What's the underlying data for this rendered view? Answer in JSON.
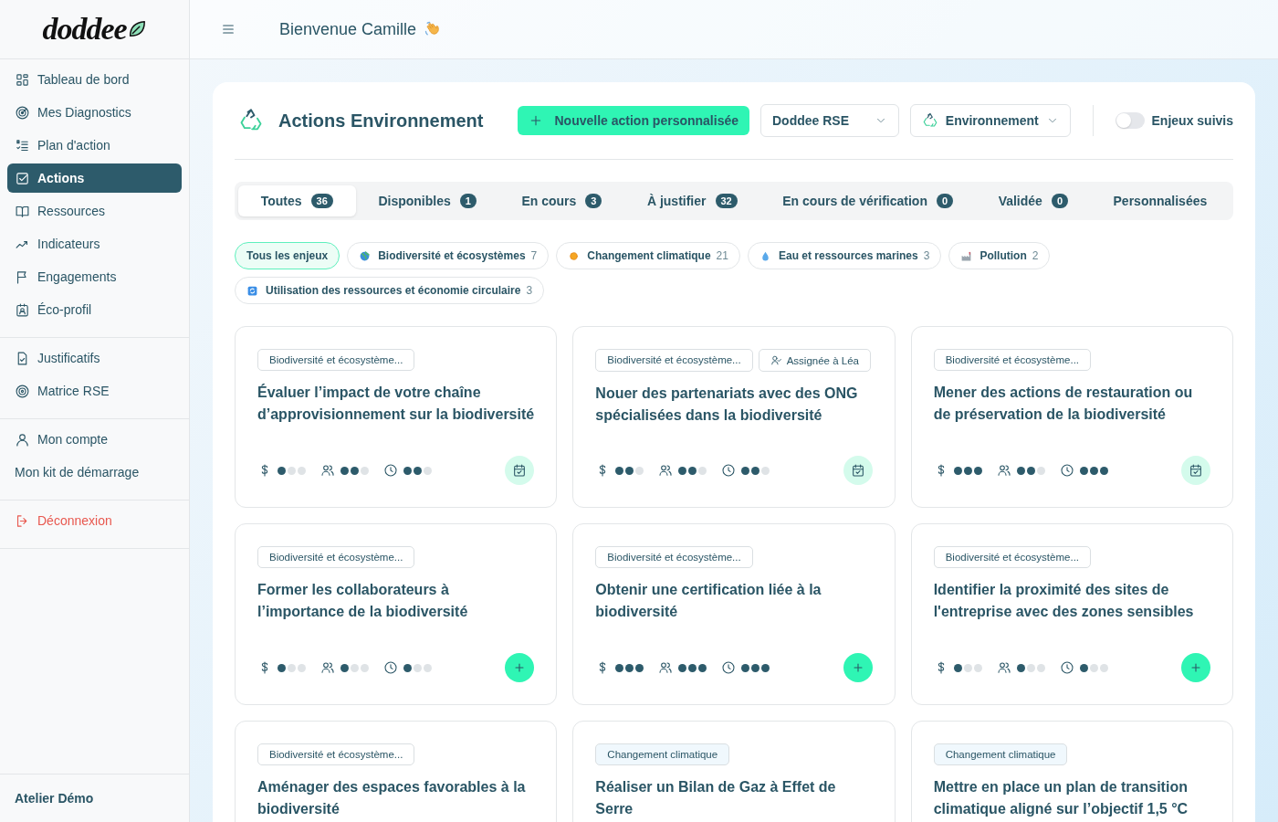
{
  "sidebar": {
    "logo": "doddee",
    "sections": [
      {
        "items": [
          {
            "label": "Tableau de bord",
            "selected": false
          },
          {
            "label": "Mes Diagnostics",
            "selected": false
          },
          {
            "label": "Plan d'action",
            "selected": false
          },
          {
            "label": "Actions",
            "selected": true
          },
          {
            "label": "Ressources",
            "selected": false
          },
          {
            "label": "Indicateurs",
            "selected": false
          },
          {
            "label": "Engagements",
            "selected": false
          },
          {
            "label": "Éco-profil",
            "selected": false
          }
        ]
      },
      {
        "items": [
          {
            "label": "Justificatifs",
            "selected": false
          },
          {
            "label": "Matrice RSE",
            "selected": false
          }
        ]
      },
      {
        "items": [
          {
            "label": "Mon compte",
            "selected": false
          },
          {
            "label": "Mon kit de démarrage",
            "selected": false
          }
        ]
      },
      {
        "items": [
          {
            "label": "Déconnexion",
            "selected": false,
            "kind": "danger"
          }
        ]
      }
    ],
    "footer": "Atelier Démo"
  },
  "header": {
    "greeting": "Bienvenue Camille"
  },
  "panel": {
    "title": "Actions Environnement",
    "new_button": "Nouvelle action personnalisée",
    "selects": [
      {
        "value": "Doddee RSE",
        "kind": "plain"
      },
      {
        "value": "Environnement",
        "kind": "recycle"
      }
    ],
    "toggle": {
      "label": "Enjeux suivis",
      "on": false
    },
    "tabs": [
      {
        "label": "Toutes",
        "count": "36",
        "selected": true
      },
      {
        "label": "Disponibles",
        "count": "1",
        "selected": false
      },
      {
        "label": "En cours",
        "count": "3",
        "selected": false
      },
      {
        "label": "À justifier",
        "count": "32",
        "selected": false
      },
      {
        "label": "En cours de vérification",
        "count": "0",
        "selected": false
      },
      {
        "label": "Validée",
        "count": "0",
        "selected": false
      },
      {
        "label": "Personnalisées",
        "selected": false
      }
    ],
    "filters": [
      {
        "label": "Tous les enjeux",
        "kind": "all",
        "selected": true
      },
      {
        "label": "Biodiversité et écosystèmes",
        "count": "7",
        "kind": "globe",
        "selected": false
      },
      {
        "label": "Changement climatique",
        "count": "21",
        "kind": "sun",
        "selected": false
      },
      {
        "label": "Eau et ressources marines",
        "count": "3",
        "kind": "drop",
        "selected": false
      },
      {
        "label": "Pollution",
        "count": "2",
        "kind": "factory",
        "selected": false
      },
      {
        "label": "Utilisation des ressources et économie circulaire",
        "count": "3",
        "kind": "cycle",
        "selected": false
      }
    ],
    "cards": [
      {
        "tag": {
          "text": "Biodiversité et écosystème...",
          "kind": "bio"
        },
        "title": "Évaluer l’impact de votre chaîne d’approvisionnement sur la biodiversité",
        "cost": {
          "stars": 1
        },
        "people": {
          "stars": 2
        },
        "time": {
          "stars": 2
        },
        "action": {
          "kind": "planned"
        }
      },
      {
        "tag": {
          "text": "Biodiversité et écosystème...",
          "kind": "bio"
        },
        "assignee": "Assignée à Léa",
        "title": "Nouer des partenariats avec des ONG spécialisées dans la biodiversité",
        "cost": {
          "stars": 2
        },
        "people": {
          "stars": 2
        },
        "time": {
          "stars": 2
        },
        "action": {
          "kind": "planned"
        }
      },
      {
        "tag": {
          "text": "Biodiversité et écosystème...",
          "kind": "bio"
        },
        "title": "Mener des actions de restauration ou de préservation de la biodiversité",
        "cost": {
          "stars": 3
        },
        "people": {
          "stars": 2
        },
        "time": {
          "stars": 3
        },
        "action": {
          "kind": "planned"
        }
      },
      {
        "tag": {
          "text": "Biodiversité et écosystème...",
          "kind": "bio"
        },
        "title": "Former les collaborateurs à l’importance de la biodiversité",
        "cost": {
          "stars": 1
        },
        "people": {
          "stars": 1
        },
        "time": {
          "stars": 1
        },
        "action": {
          "kind": "add"
        }
      },
      {
        "tag": {
          "text": "Biodiversité et écosystème...",
          "kind": "bio"
        },
        "title": "Obtenir une certification liée à la biodiversité",
        "cost": {
          "stars": 3
        },
        "people": {
          "stars": 3
        },
        "time": {
          "stars": 3
        },
        "action": {
          "kind": "add"
        }
      },
      {
        "tag": {
          "text": "Biodiversité et écosystème...",
          "kind": "bio"
        },
        "title": "Identifier la proximité des sites de l'entreprise avec des zones sensibles",
        "cost": {
          "stars": 1
        },
        "people": {
          "stars": 1
        },
        "time": {
          "stars": 1
        },
        "action": {
          "kind": "add"
        }
      },
      {
        "tag": {
          "text": "Biodiversité et écosystème...",
          "kind": "bio"
        },
        "title": "Aménager des espaces favorables à la biodiversité"
      },
      {
        "tag": {
          "text": "Changement climatique",
          "kind": "climate"
        },
        "title": "Réaliser un Bilan de Gaz à Effet de Serre"
      },
      {
        "tag": {
          "text": "Changement climatique",
          "kind": "climate"
        },
        "title": "Mettre en place un plan de transition climatique aligné sur l’objectif 1,5 °C"
      }
    ]
  }
}
